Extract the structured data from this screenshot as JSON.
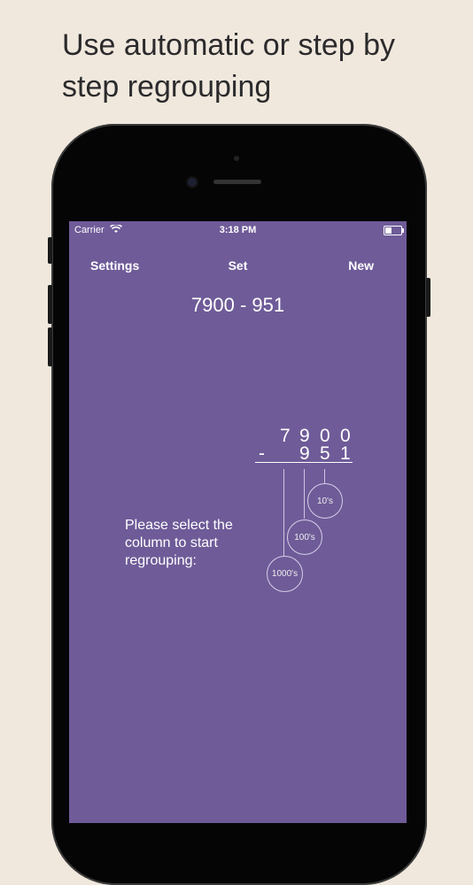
{
  "headline": "Use automatic or step by step regrouping",
  "status": {
    "carrier": "Carrier",
    "time": "3:18 PM"
  },
  "nav": {
    "settings": "Settings",
    "set": "Set",
    "new": "New"
  },
  "problem": "7900 - 951",
  "work": {
    "top_digits": [
      "7",
      "9",
      "0",
      "0"
    ],
    "minus": "-",
    "bottom_digits": [
      "9",
      "5",
      "1"
    ]
  },
  "columns": [
    "10's",
    "100's",
    "1000's"
  ],
  "prompt": "Please select the column to start regrouping:"
}
